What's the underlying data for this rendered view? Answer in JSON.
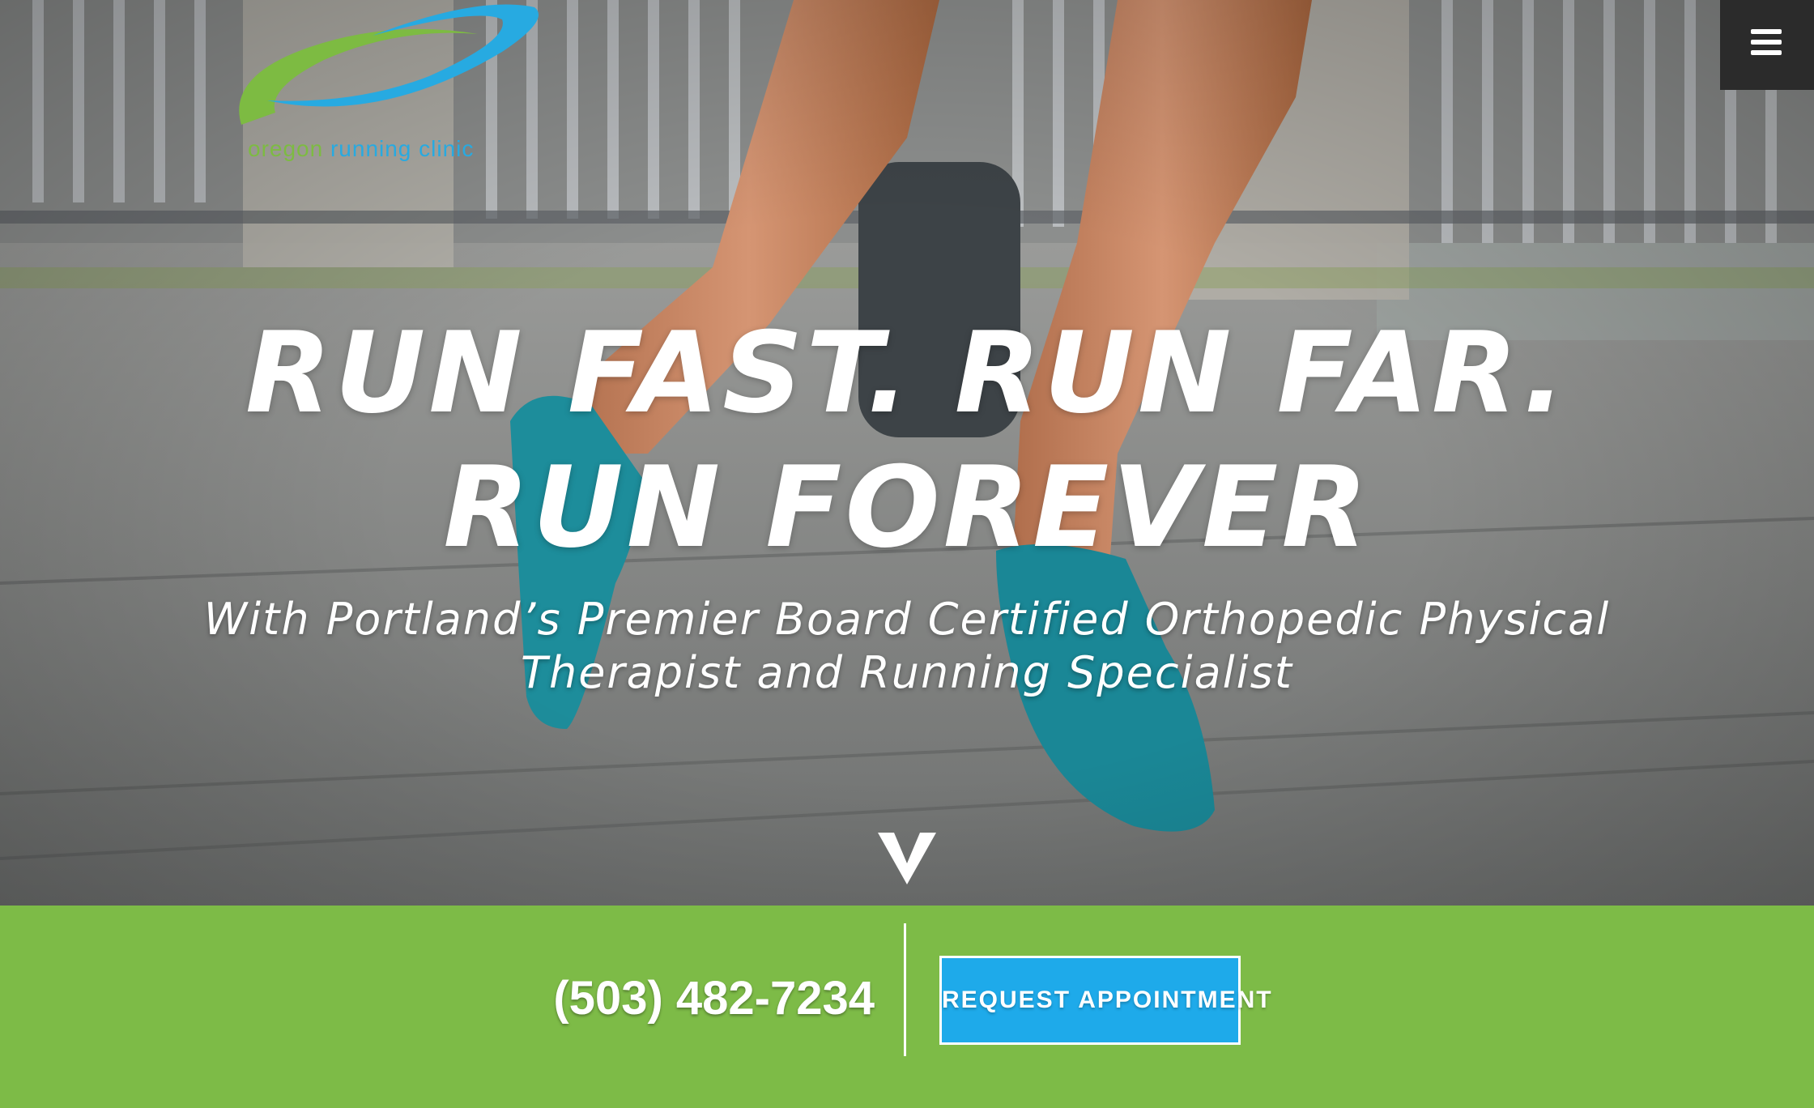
{
  "logo": {
    "word1": "oregon",
    "word2": "running",
    "word3": "clinic",
    "colors": {
      "green": "#7dbb42",
      "blue": "#27aae1"
    }
  },
  "menu": {
    "icon": "hamburger-menu-icon"
  },
  "hero": {
    "headline_line1": "RUN FAST. RUN FAR.",
    "headline_line2": "RUN FOREVER",
    "sub_line1": "With Portland’s Premier Board Certified Orthopedic Physical",
    "sub_line2": "Therapist and Running Specialist",
    "scroll_icon": "chevron-down-icon"
  },
  "cta": {
    "phone": "(503) 482-7234",
    "button_label": "REQUEST APPOINTMENT",
    "colors": {
      "bar": "#7dbb47",
      "button": "#1eaaea"
    }
  }
}
